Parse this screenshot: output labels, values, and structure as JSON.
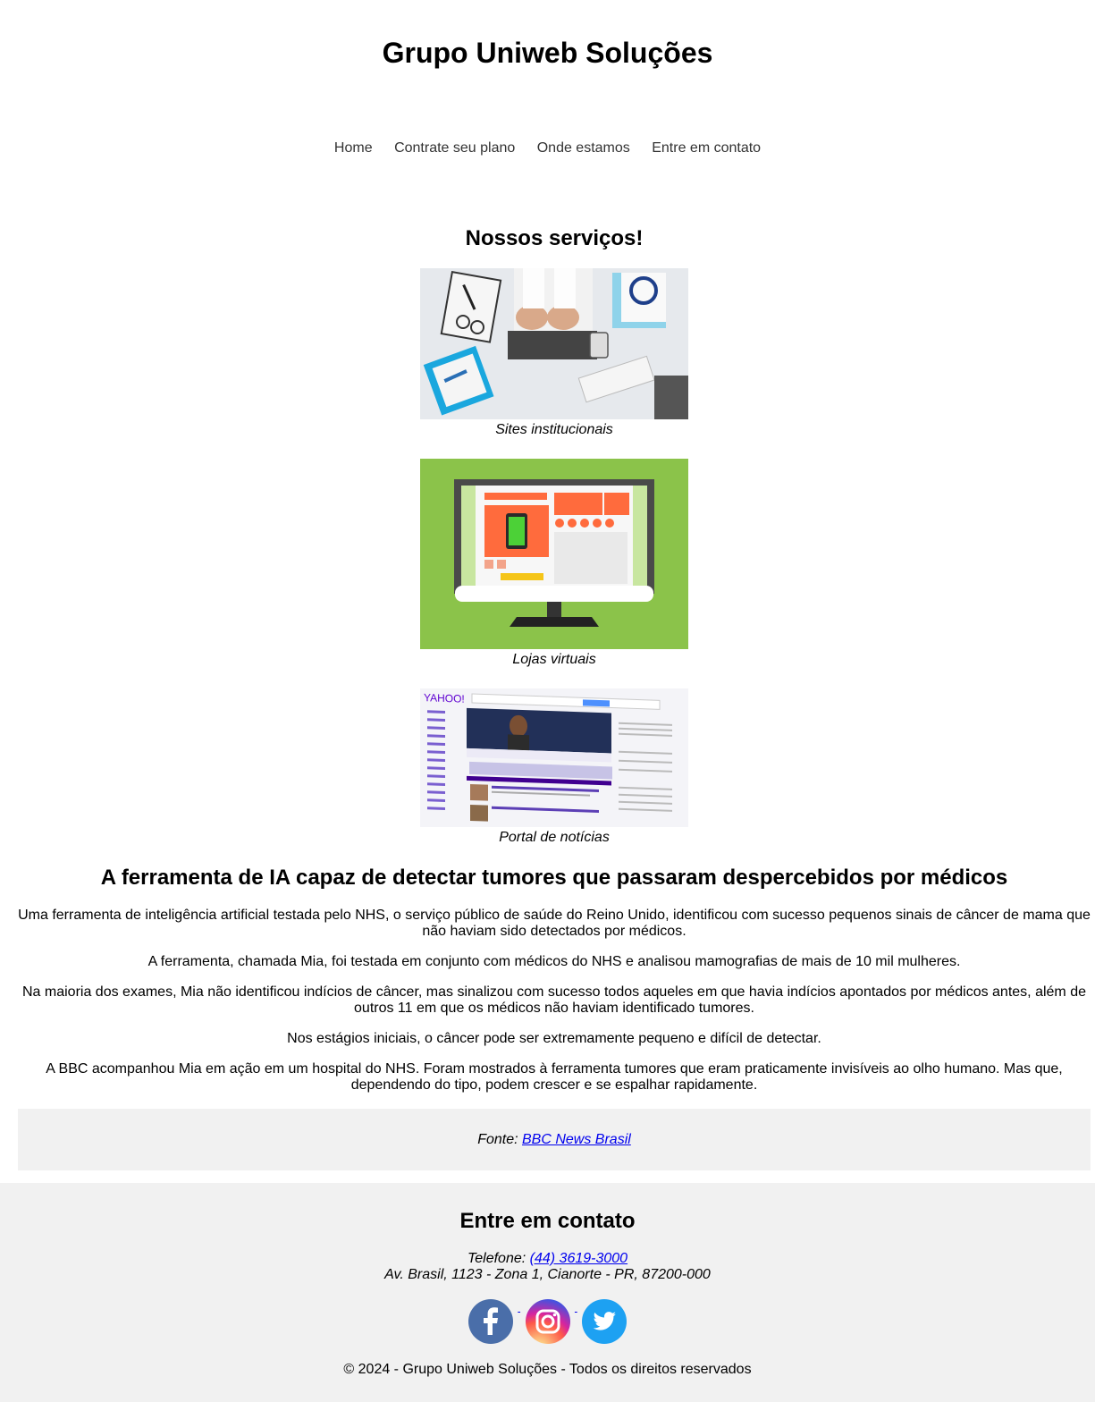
{
  "header": {
    "title": "Grupo Uniweb Soluções"
  },
  "nav": {
    "items": [
      {
        "label": "Home"
      },
      {
        "label": "Contrate seu plano"
      },
      {
        "label": "Onde estamos"
      },
      {
        "label": "Entre em contato"
      }
    ]
  },
  "services": {
    "title": "Nossos serviços!",
    "items": [
      {
        "caption": "Sites institucionais",
        "image": "desk-laptop-photo"
      },
      {
        "caption": "Lojas virtuais",
        "image": "ecommerce-monitor-illustration"
      },
      {
        "caption": "Portal de notícias",
        "image": "news-portal-screenshot",
        "image_brand": "YAHOO!"
      }
    ]
  },
  "article": {
    "title": "A ferramenta de IA capaz de detectar tumores que passaram despercebidos por médicos",
    "paragraphs": [
      "Uma ferramenta de inteligência artificial testada pelo NHS, o serviço público de saúde do Reino Unido, identificou com sucesso pequenos sinais de câncer de mama que não haviam sido detectados por médicos.",
      "A ferramenta, chamada Mia, foi testada em conjunto com médicos do NHS e analisou mamografias de mais de 10 mil mulheres.",
      "Na maioria dos exames, Mia não identificou indícios de câncer, mas sinalizou com sucesso todos aqueles em que havia indícios apontados por médicos antes, além de outros 11 em que os médicos não haviam identificado tumores.",
      "Nos estágios iniciais, o câncer pode ser extremamente pequeno e difícil de detectar.",
      "A BBC acompanhou Mia em ação em um hospital do NHS. Foram mostrados à ferramenta tumores que eram praticamente invisíveis ao olho humano. Mas que, dependendo do tipo, podem crescer e se espalhar rapidamente."
    ],
    "source_label": "Fonte:",
    "source_link": "BBC News Brasil"
  },
  "footer": {
    "title": "Entre em contato",
    "phone_label": "Telefone:",
    "phone": "(44) 3619-3000",
    "address": "Av. Brasil, 1123 - Zona 1, Cianorte - PR, 87200-000",
    "socials": [
      {
        "name": "facebook",
        "icon": "facebook-icon",
        "color": "#4a6ea9"
      },
      {
        "name": "instagram",
        "icon": "instagram-icon",
        "color": "#c13584"
      },
      {
        "name": "twitter",
        "icon": "twitter-icon",
        "color": "#1da1f2"
      }
    ],
    "copyright": "© 2024 - Grupo Uniweb Soluções - Todos os direitos reservados"
  }
}
